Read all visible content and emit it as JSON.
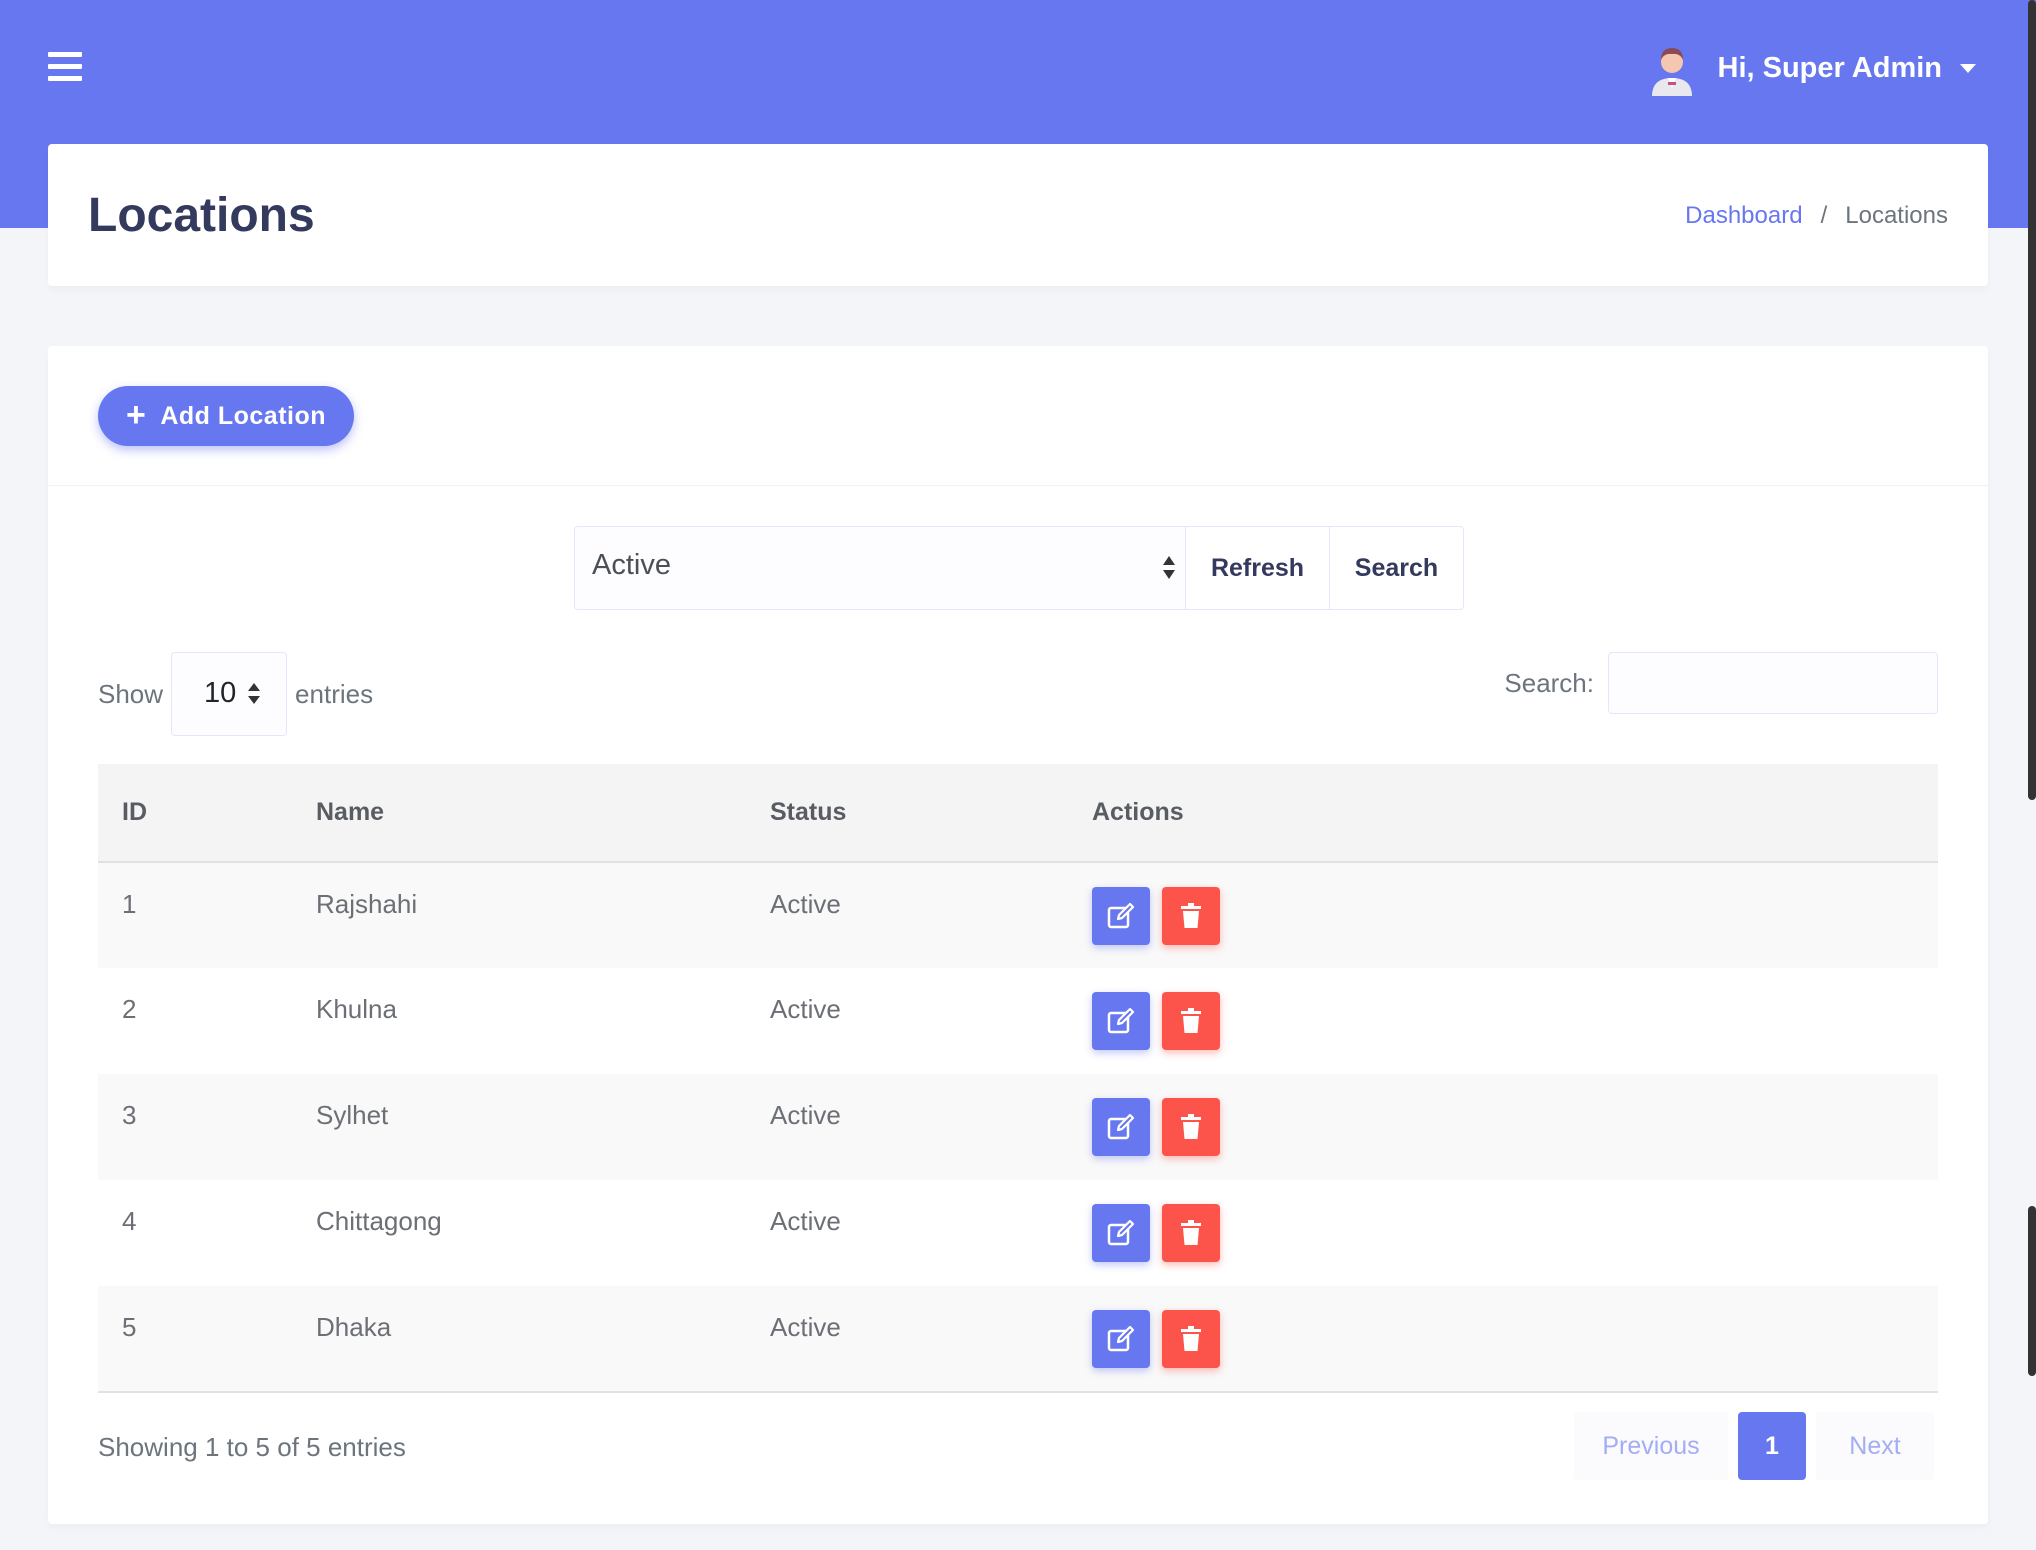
{
  "topbar": {
    "user_greeting": "Hi, Super Admin",
    "accent_color": "#6777ef"
  },
  "header": {
    "title": "Locations",
    "breadcrumb": {
      "link": "Dashboard",
      "separator": "/",
      "current": "Locations"
    }
  },
  "toolbar": {
    "add_label": "Add Location",
    "status_filter_value": "Active",
    "refresh_label": "Refresh",
    "search_label": "Search"
  },
  "datatable": {
    "show_label": "Show",
    "length_value": "10",
    "entries_label": "entries",
    "search_label": "Search:",
    "search_value": "",
    "columns": [
      "ID",
      "Name",
      "Status",
      "Actions"
    ],
    "rows": [
      {
        "id": "1",
        "name": "Rajshahi",
        "status": "Active"
      },
      {
        "id": "2",
        "name": "Khulna",
        "status": "Active"
      },
      {
        "id": "3",
        "name": "Sylhet",
        "status": "Active"
      },
      {
        "id": "4",
        "name": "Chittagong",
        "status": "Active"
      },
      {
        "id": "5",
        "name": "Dhaka",
        "status": "Active"
      }
    ],
    "info": "Showing 1 to 5 of 5 entries",
    "pagination": {
      "previous": "Previous",
      "current_page": "1",
      "next": "Next"
    }
  },
  "colors": {
    "primary": "#6777ef",
    "danger": "#fc544b"
  }
}
